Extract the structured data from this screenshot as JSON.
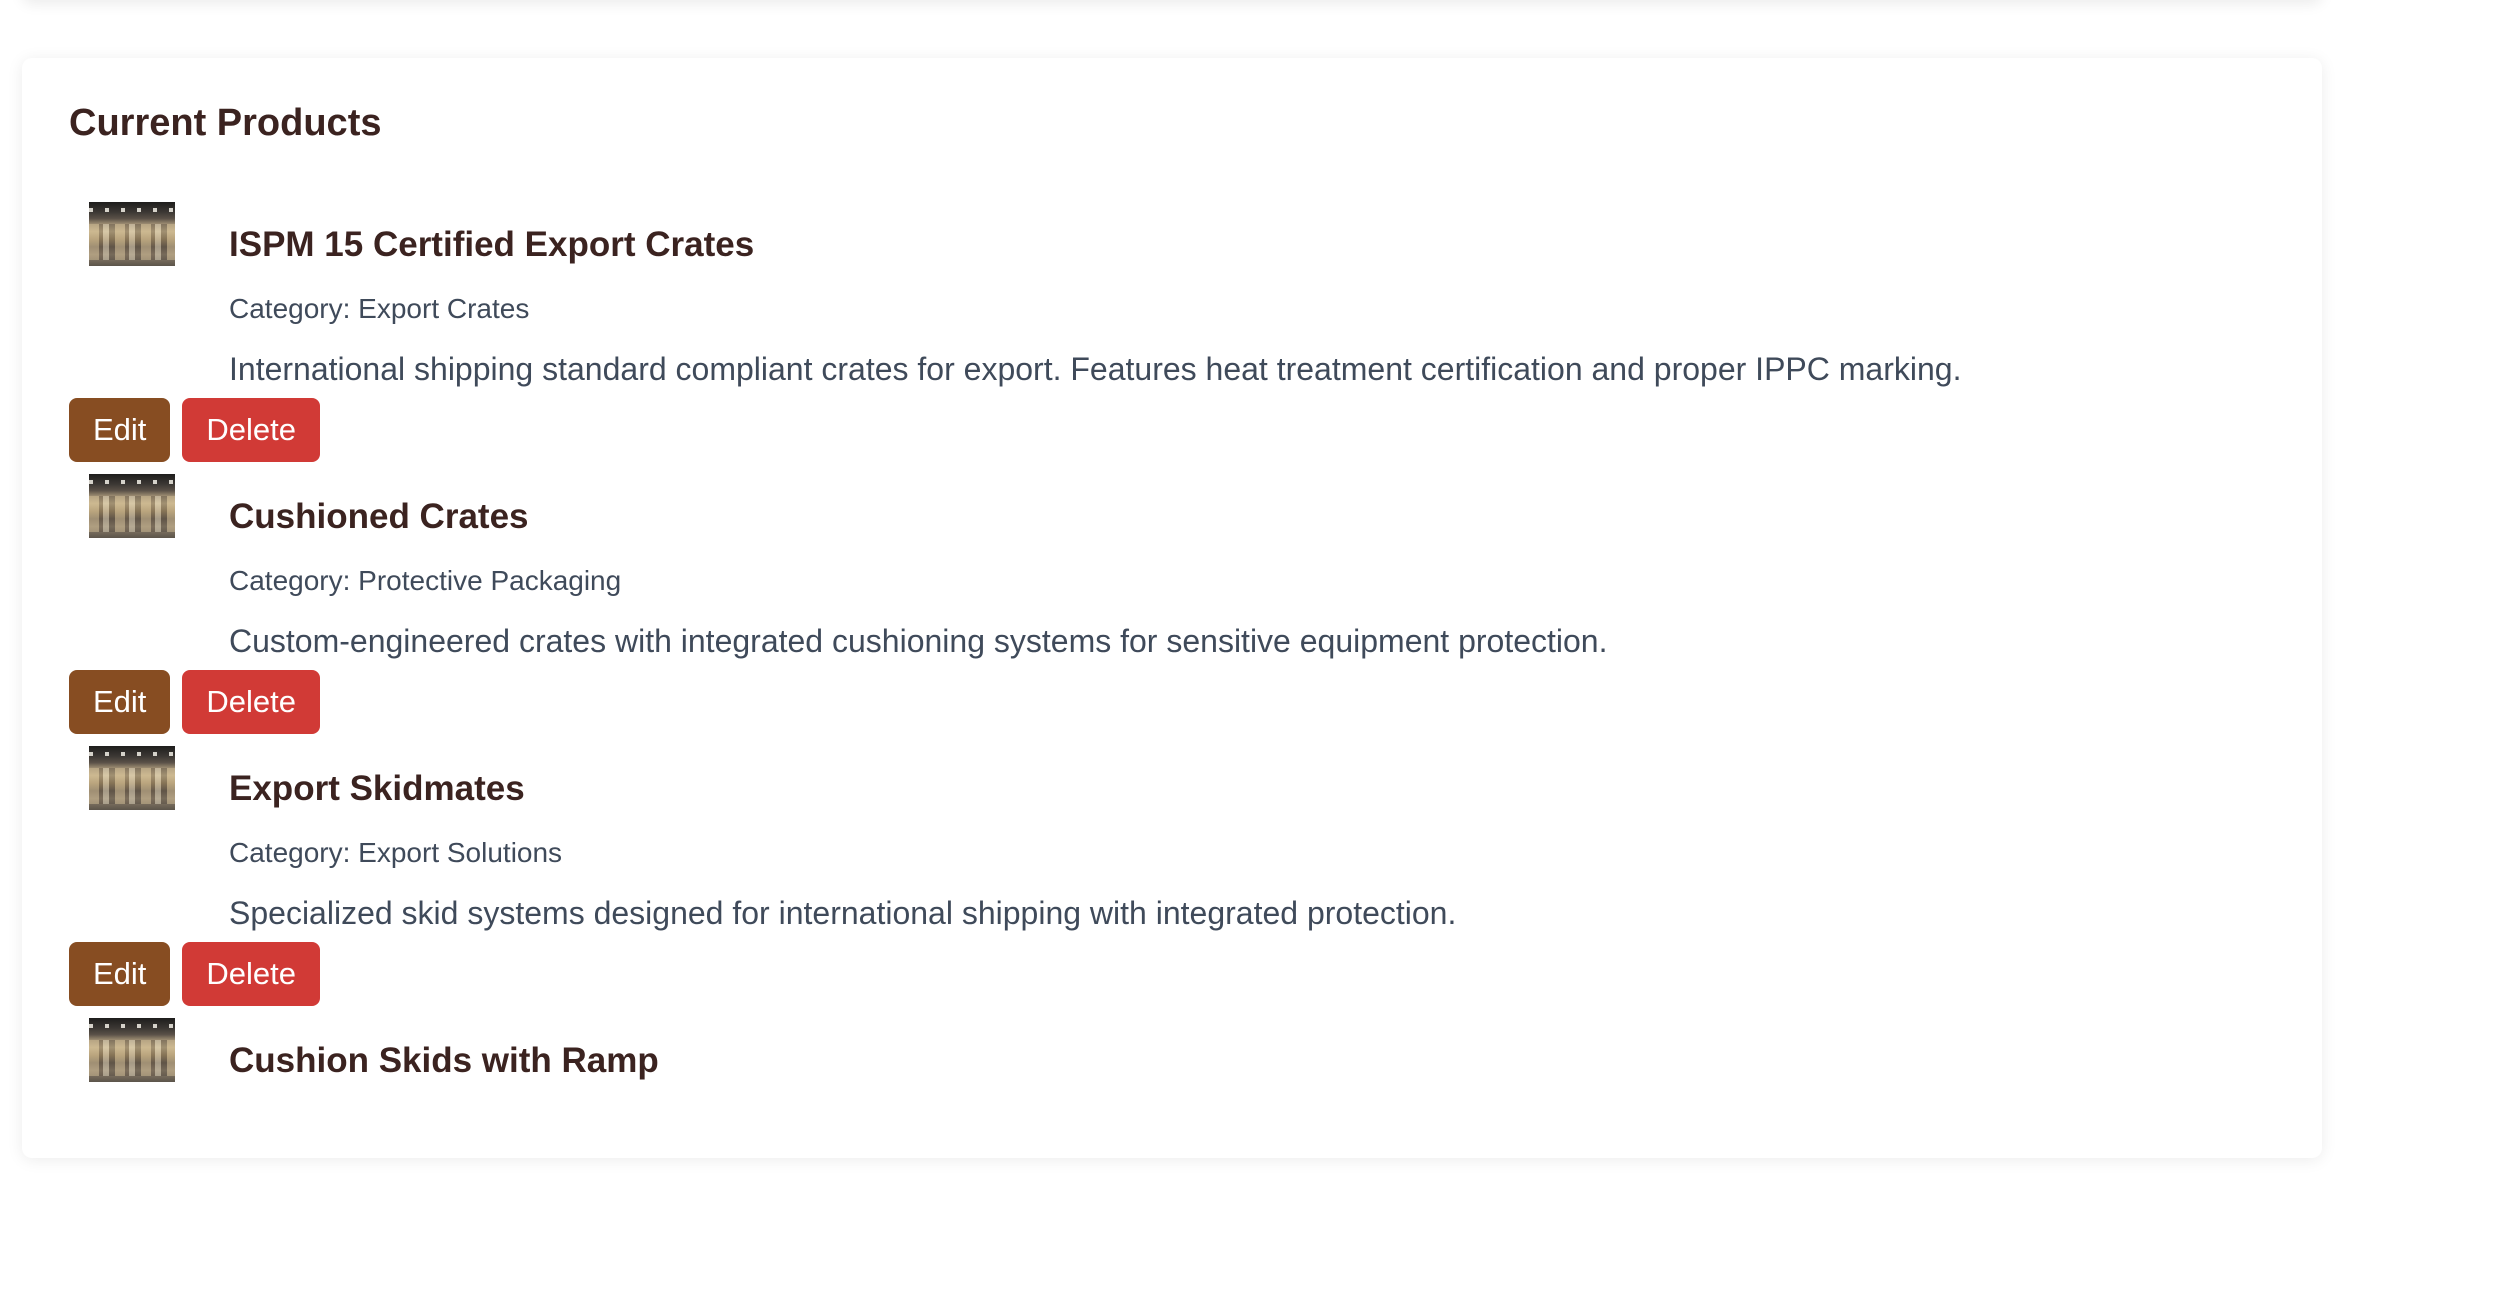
{
  "section": {
    "title": "Current Products"
  },
  "colors": {
    "heading": "#3b2320",
    "text": "#3f4a5a",
    "edit": "#874d22",
    "delete": "#d13a36"
  },
  "actions": {
    "edit_label": "Edit",
    "delete_label": "Delete"
  },
  "products": [
    {
      "name": "ISPM 15 Certified Export Crates",
      "category": "Category: Export Crates",
      "description": "International shipping standard compliant crates for export. Features heat treatment certification and proper IPPC marking."
    },
    {
      "name": "Cushioned Crates",
      "category": "Category: Protective Packaging",
      "description": "Custom-engineered crates with integrated cushioning systems for sensitive equipment protection."
    },
    {
      "name": "Export Skidmates",
      "category": "Category: Export Solutions",
      "description": "Specialized skid systems designed for international shipping with integrated protection."
    },
    {
      "name": "Cushion Skids with Ramp",
      "category": "",
      "description": ""
    }
  ]
}
